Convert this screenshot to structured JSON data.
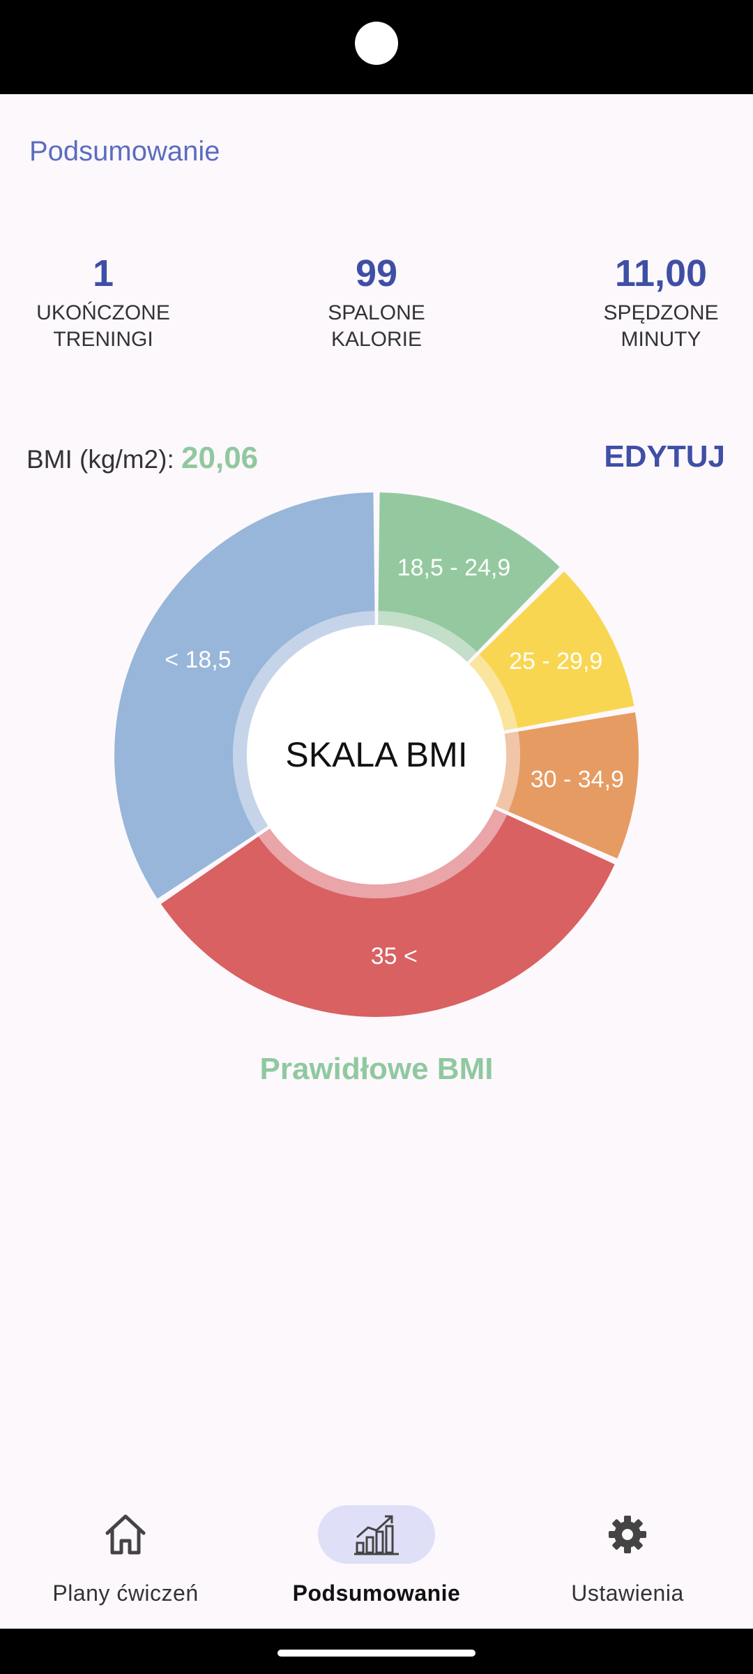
{
  "header": {
    "title": "Podsumowanie"
  },
  "stats": [
    {
      "value": "1",
      "label_line1": "UKOŃCZONE",
      "label_line2": "TRENINGI"
    },
    {
      "value": "99",
      "label_line1": "SPALONE",
      "label_line2": "KALORIE"
    },
    {
      "value": "11,00",
      "label_line1": "SPĘDZONE",
      "label_line2": "MINUTY"
    }
  ],
  "bmi": {
    "label": "BMI (kg/m2):",
    "value": "20,06",
    "value_color": "#90c8a0",
    "edit_label": "EDYTUJ",
    "status": "Prawidłowe BMI",
    "status_color": "#90c8a0"
  },
  "chart_data": {
    "type": "pie",
    "title": "",
    "center_label": "SKALA BMI",
    "categories": [
      "< 18,5",
      "18,5 - 24,9",
      "25 - 29,9",
      "30 - 34,9",
      "35 <"
    ],
    "colors": [
      "#97b6d9",
      "#94c99f",
      "#f9d651",
      "#e69b63",
      "#d96161"
    ],
    "values": [
      124,
      45,
      35,
      34,
      122
    ]
  },
  "bottom_nav": {
    "items": [
      {
        "label": "Plany ćwiczeń",
        "icon": "home-icon",
        "active": false
      },
      {
        "label": "Podsumowanie",
        "icon": "chart-icon",
        "active": true
      },
      {
        "label": "Ustawienia",
        "icon": "gear-icon",
        "active": false
      }
    ]
  }
}
